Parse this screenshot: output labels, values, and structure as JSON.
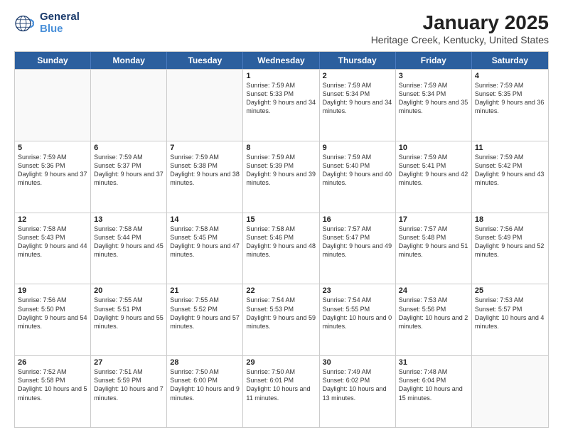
{
  "logo": {
    "line1": "General",
    "line2": "Blue"
  },
  "title": "January 2025",
  "subtitle": "Heritage Creek, Kentucky, United States",
  "days_of_week": [
    "Sunday",
    "Monday",
    "Tuesday",
    "Wednesday",
    "Thursday",
    "Friday",
    "Saturday"
  ],
  "weeks": [
    [
      {
        "day": "",
        "empty": true
      },
      {
        "day": "",
        "empty": true
      },
      {
        "day": "",
        "empty": true
      },
      {
        "day": "1",
        "sunrise": "7:59 AM",
        "sunset": "5:33 PM",
        "daylight": "9 hours and 34 minutes."
      },
      {
        "day": "2",
        "sunrise": "7:59 AM",
        "sunset": "5:34 PM",
        "daylight": "9 hours and 34 minutes."
      },
      {
        "day": "3",
        "sunrise": "7:59 AM",
        "sunset": "5:34 PM",
        "daylight": "9 hours and 35 minutes."
      },
      {
        "day": "4",
        "sunrise": "7:59 AM",
        "sunset": "5:35 PM",
        "daylight": "9 hours and 36 minutes."
      }
    ],
    [
      {
        "day": "5",
        "sunrise": "7:59 AM",
        "sunset": "5:36 PM",
        "daylight": "9 hours and 37 minutes."
      },
      {
        "day": "6",
        "sunrise": "7:59 AM",
        "sunset": "5:37 PM",
        "daylight": "9 hours and 37 minutes."
      },
      {
        "day": "7",
        "sunrise": "7:59 AM",
        "sunset": "5:38 PM",
        "daylight": "9 hours and 38 minutes."
      },
      {
        "day": "8",
        "sunrise": "7:59 AM",
        "sunset": "5:39 PM",
        "daylight": "9 hours and 39 minutes."
      },
      {
        "day": "9",
        "sunrise": "7:59 AM",
        "sunset": "5:40 PM",
        "daylight": "9 hours and 40 minutes."
      },
      {
        "day": "10",
        "sunrise": "7:59 AM",
        "sunset": "5:41 PM",
        "daylight": "9 hours and 42 minutes."
      },
      {
        "day": "11",
        "sunrise": "7:59 AM",
        "sunset": "5:42 PM",
        "daylight": "9 hours and 43 minutes."
      }
    ],
    [
      {
        "day": "12",
        "sunrise": "7:58 AM",
        "sunset": "5:43 PM",
        "daylight": "9 hours and 44 minutes."
      },
      {
        "day": "13",
        "sunrise": "7:58 AM",
        "sunset": "5:44 PM",
        "daylight": "9 hours and 45 minutes."
      },
      {
        "day": "14",
        "sunrise": "7:58 AM",
        "sunset": "5:45 PM",
        "daylight": "9 hours and 47 minutes."
      },
      {
        "day": "15",
        "sunrise": "7:58 AM",
        "sunset": "5:46 PM",
        "daylight": "9 hours and 48 minutes."
      },
      {
        "day": "16",
        "sunrise": "7:57 AM",
        "sunset": "5:47 PM",
        "daylight": "9 hours and 49 minutes."
      },
      {
        "day": "17",
        "sunrise": "7:57 AM",
        "sunset": "5:48 PM",
        "daylight": "9 hours and 51 minutes."
      },
      {
        "day": "18",
        "sunrise": "7:56 AM",
        "sunset": "5:49 PM",
        "daylight": "9 hours and 52 minutes."
      }
    ],
    [
      {
        "day": "19",
        "sunrise": "7:56 AM",
        "sunset": "5:50 PM",
        "daylight": "9 hours and 54 minutes."
      },
      {
        "day": "20",
        "sunrise": "7:55 AM",
        "sunset": "5:51 PM",
        "daylight": "9 hours and 55 minutes."
      },
      {
        "day": "21",
        "sunrise": "7:55 AM",
        "sunset": "5:52 PM",
        "daylight": "9 hours and 57 minutes."
      },
      {
        "day": "22",
        "sunrise": "7:54 AM",
        "sunset": "5:53 PM",
        "daylight": "9 hours and 59 minutes."
      },
      {
        "day": "23",
        "sunrise": "7:54 AM",
        "sunset": "5:55 PM",
        "daylight": "10 hours and 0 minutes."
      },
      {
        "day": "24",
        "sunrise": "7:53 AM",
        "sunset": "5:56 PM",
        "daylight": "10 hours and 2 minutes."
      },
      {
        "day": "25",
        "sunrise": "7:53 AM",
        "sunset": "5:57 PM",
        "daylight": "10 hours and 4 minutes."
      }
    ],
    [
      {
        "day": "26",
        "sunrise": "7:52 AM",
        "sunset": "5:58 PM",
        "daylight": "10 hours and 5 minutes."
      },
      {
        "day": "27",
        "sunrise": "7:51 AM",
        "sunset": "5:59 PM",
        "daylight": "10 hours and 7 minutes."
      },
      {
        "day": "28",
        "sunrise": "7:50 AM",
        "sunset": "6:00 PM",
        "daylight": "10 hours and 9 minutes."
      },
      {
        "day": "29",
        "sunrise": "7:50 AM",
        "sunset": "6:01 PM",
        "daylight": "10 hours and 11 minutes."
      },
      {
        "day": "30",
        "sunrise": "7:49 AM",
        "sunset": "6:02 PM",
        "daylight": "10 hours and 13 minutes."
      },
      {
        "day": "31",
        "sunrise": "7:48 AM",
        "sunset": "6:04 PM",
        "daylight": "10 hours and 15 minutes."
      },
      {
        "day": "",
        "empty": true
      }
    ]
  ]
}
